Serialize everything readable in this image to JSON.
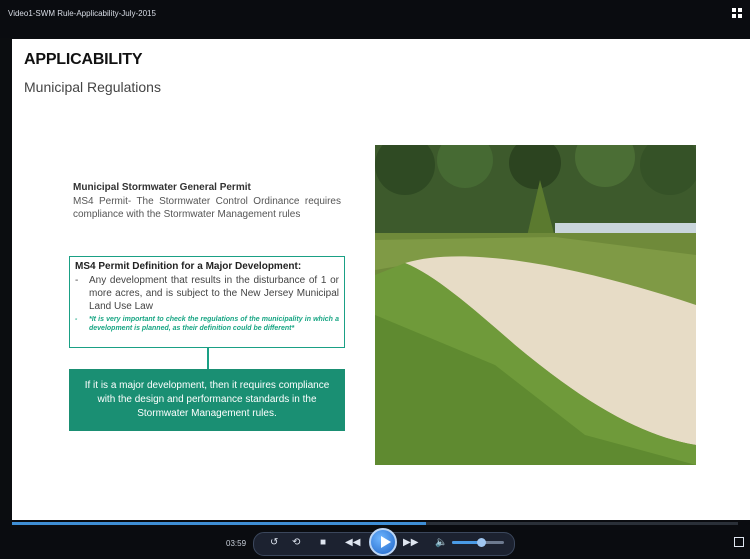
{
  "window": {
    "title": "Video1-SWM Rule-Applicability-July-2015",
    "grid_icon": "grid-icon"
  },
  "slide": {
    "title": "APPLICABILITY",
    "subtitle": "Municipal Regulations",
    "permit": {
      "heading": "Municipal Stormwater General Permit",
      "text": "MS4 Permit- The Stormwater Control Ordinance requires compliance with the Stormwater Management rules"
    },
    "definition": {
      "heading": "MS4 Permit Definition for a Major Development:",
      "dash": "-",
      "item": "Any development that results in the disturbance of 1 or more acres, and is subject to the New Jersey Municipal Land Use Law",
      "note": "*It is very important to check the regulations of the municipality in which a development is planned, as their definition could be different*"
    },
    "callout": "If it is a major development, then it requires compliance with the design and performance standards in the Stormwater Management rules.",
    "photo_description_icon": "basin-photo"
  },
  "player": {
    "time": "03:59",
    "progress": 0.57,
    "volume": 0.55,
    "accent": "#3f8fd6",
    "icons": [
      "rewind-loop-icon",
      "replay-icon",
      "stop-icon",
      "rewind-icon",
      "play-icon",
      "fast-forward-icon",
      "volume-icon",
      "fullscreen-icon"
    ]
  },
  "colors": {
    "accent_green": "#1a8f73",
    "border_green": "#1aa085"
  }
}
